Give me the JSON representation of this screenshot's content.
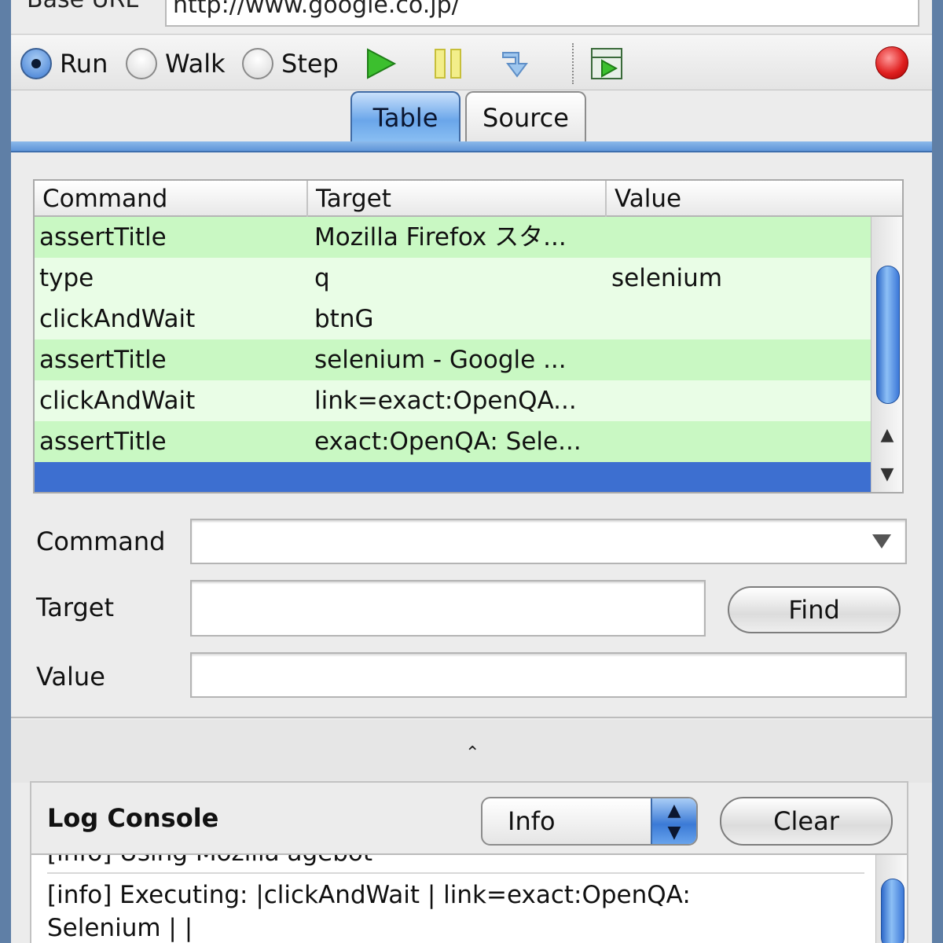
{
  "window": {
    "base_url_label": "Base URL",
    "base_url_value": "http://www.google.co.jp/"
  },
  "toolbar": {
    "speed_options": [
      {
        "label": "Run",
        "selected": true
      },
      {
        "label": "Walk",
        "selected": false
      },
      {
        "label": "Step",
        "selected": false
      }
    ],
    "icons": [
      "play-icon",
      "pause-icon",
      "step-icon",
      "play-suite-icon",
      "record-icon"
    ],
    "accent": "#3d6fd0"
  },
  "tabs": [
    {
      "label": "Table",
      "active": true
    },
    {
      "label": "Source",
      "active": false
    }
  ],
  "table": {
    "headers": [
      "Command",
      "Target",
      "Value"
    ],
    "rows": [
      {
        "command": "assertTitle",
        "target": "Mozilla Firefox スタ...",
        "value": "",
        "status": "passed"
      },
      {
        "command": "type",
        "target": "q",
        "value": "selenium",
        "status": "done"
      },
      {
        "command": "clickAndWait",
        "target": "btnG",
        "value": "",
        "status": "done"
      },
      {
        "command": "assertTitle",
        "target": "selenium - Google ...",
        "value": "",
        "status": "passed"
      },
      {
        "command": "clickAndWait",
        "target": "link=exact:OpenQA...",
        "value": "",
        "status": "done"
      },
      {
        "command": "assertTitle",
        "target": "exact:OpenQA: Sele...",
        "value": "",
        "status": "passed"
      },
      {
        "command": "",
        "target": "",
        "value": "",
        "status": "selected"
      }
    ],
    "colors": {
      "passed": "#c9f8c3",
      "done": "#e9fde6",
      "selected": "#3d6fd0"
    }
  },
  "editor": {
    "command_label": "Command",
    "command_value": "",
    "target_label": "Target",
    "target_value": "",
    "find_label": "Find",
    "value_label": "Value",
    "value_value": ""
  },
  "log": {
    "title": "Log Console",
    "level": "Info",
    "clear_label": "Clear",
    "lines": [
      "[info] Using Mozilla agebot",
      "[info] Executing: |clickAndWait | link=exact:OpenQA:",
      "Selenium | |"
    ]
  }
}
